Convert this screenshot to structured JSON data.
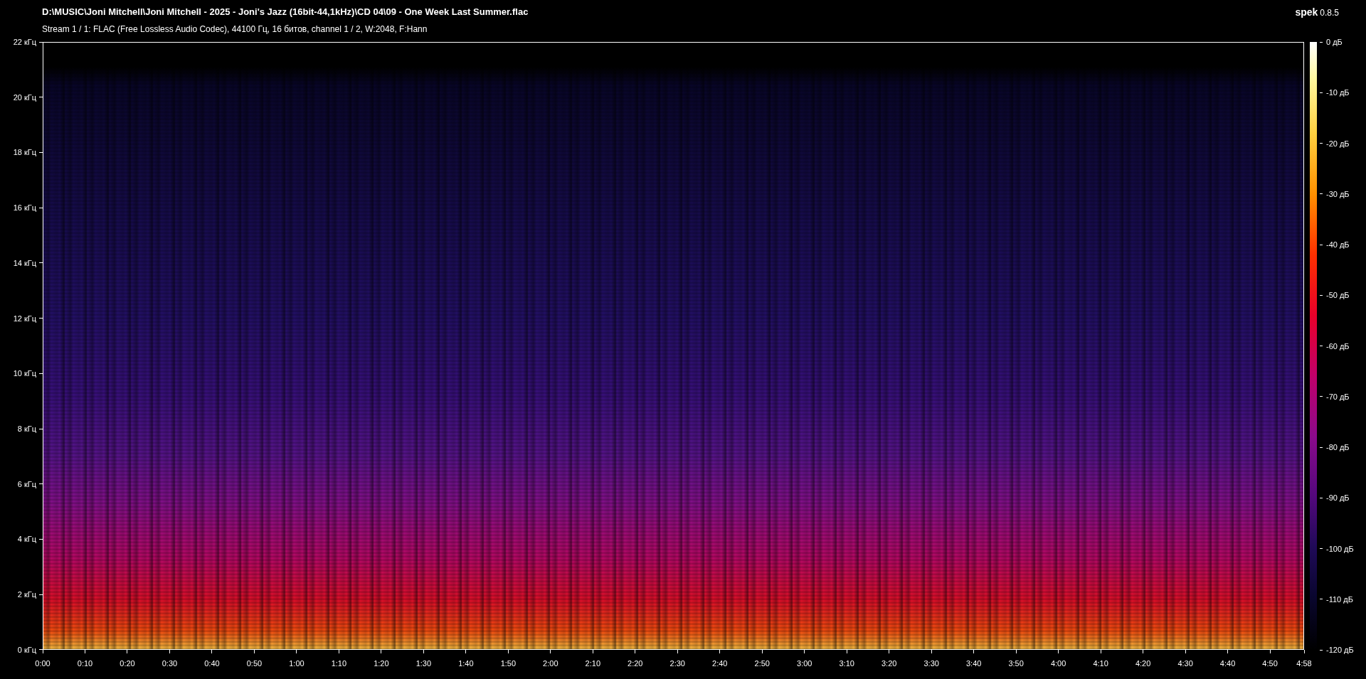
{
  "file_path": "D:\\MUSIC\\Joni Mitchell\\Joni Mitchell - 2025 - Joni's Jazz (16bit-44,1kHz)\\CD 04\\09 - One Week Last Summer.flac",
  "stream_info": "Stream 1 / 1: FLAC (Free Lossless Audio Codec), 44100 Гц, 16 битов, channel 1 / 2, W:2048, F:Hann",
  "app_name": "spek",
  "app_version": "0.8.5",
  "frequency_axis": [
    "22 кГц",
    "20 кГц",
    "18 кГц",
    "16 кГц",
    "14 кГц",
    "12 кГц",
    "10 кГц",
    "8 кГц",
    "6 кГц",
    "4 кГц",
    "2 кГц",
    "0 кГц"
  ],
  "time_axis": [
    "0:00",
    "0:10",
    "0:20",
    "0:30",
    "0:40",
    "0:50",
    "1:00",
    "1:10",
    "1:20",
    "1:30",
    "1:40",
    "1:50",
    "2:00",
    "2:10",
    "2:20",
    "2:30",
    "2:40",
    "2:50",
    "3:00",
    "3:10",
    "3:20",
    "3:30",
    "3:40",
    "3:50",
    "4:00",
    "4:10",
    "4:20",
    "4:30",
    "4:40",
    "4:50"
  ],
  "time_end": "4:58",
  "db_scale": [
    "0 дБ",
    "-10 дБ",
    "-20 дБ",
    "-30 дБ",
    "-40 дБ",
    "-50 дБ",
    "-60 дБ",
    "-70 дБ",
    "-80 дБ",
    "-90 дБ",
    "-100 дБ",
    "-110 дБ",
    "-120 дБ"
  ]
}
